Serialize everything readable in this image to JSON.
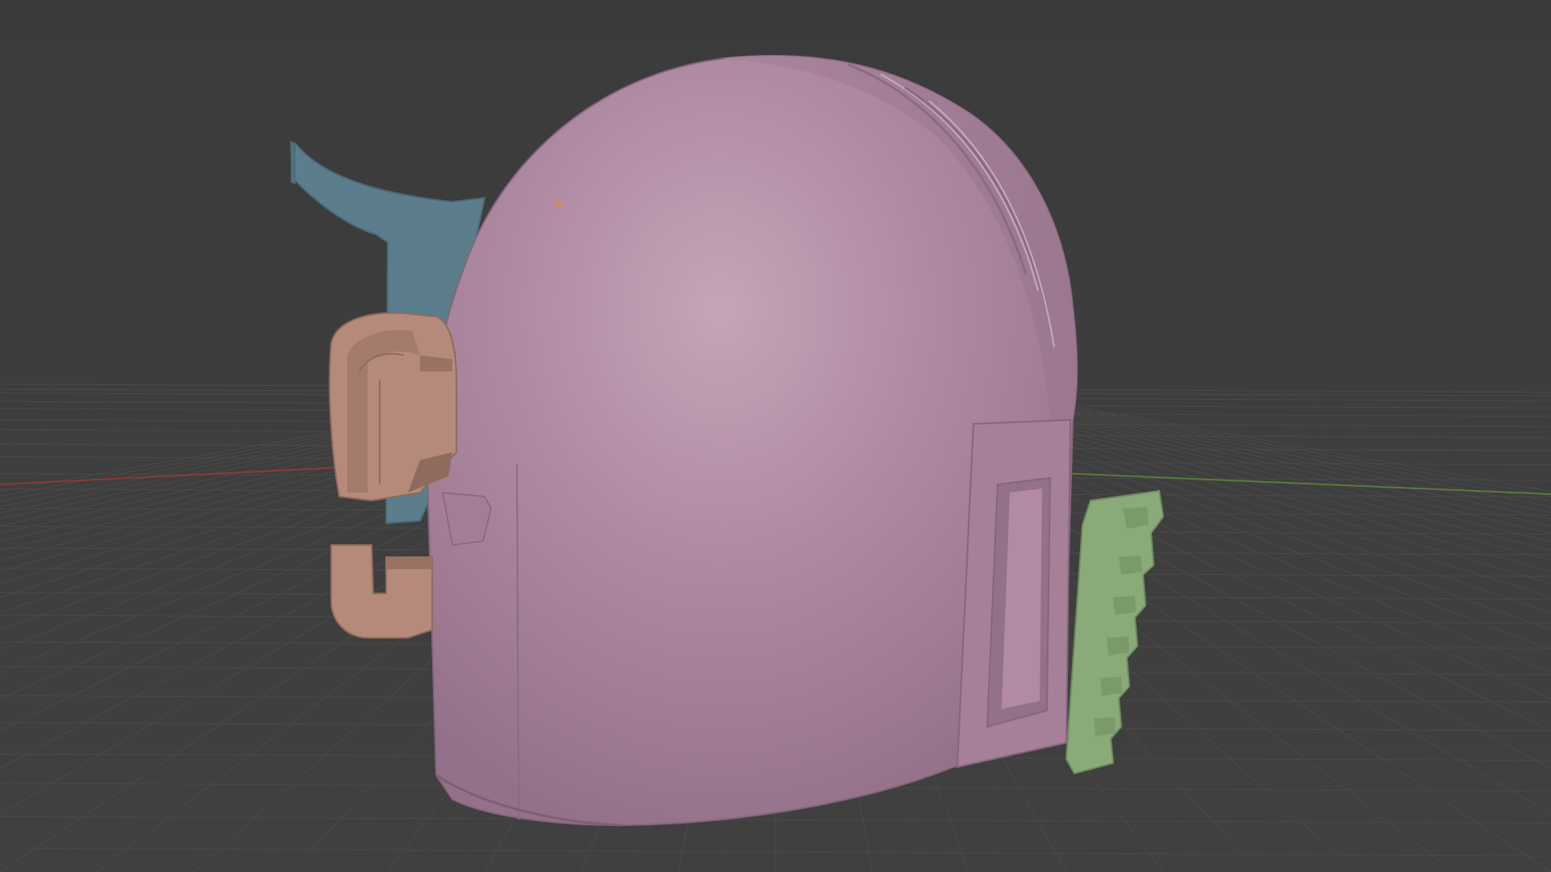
{
  "viewport": {
    "kind": "3d-viewport",
    "colors": {
      "background": "#3d3d3d",
      "grid_line": "#4a4a4a",
      "x_axis": "#8a3a3a",
      "y_axis": "#5a7a3a"
    }
  },
  "scene": {
    "objects": [
      {
        "name": "helmet-dome",
        "color": "#b48aa6"
      },
      {
        "name": "left-fin",
        "color": "#5b7d8c"
      },
      {
        "name": "ear-cap",
        "color": "#b58a7a"
      },
      {
        "name": "ear-hook",
        "color": "#b58a7a"
      },
      {
        "name": "side-comb",
        "color": "#8aaa7a"
      }
    ],
    "selected_origin_color": "#e08a2a"
  }
}
